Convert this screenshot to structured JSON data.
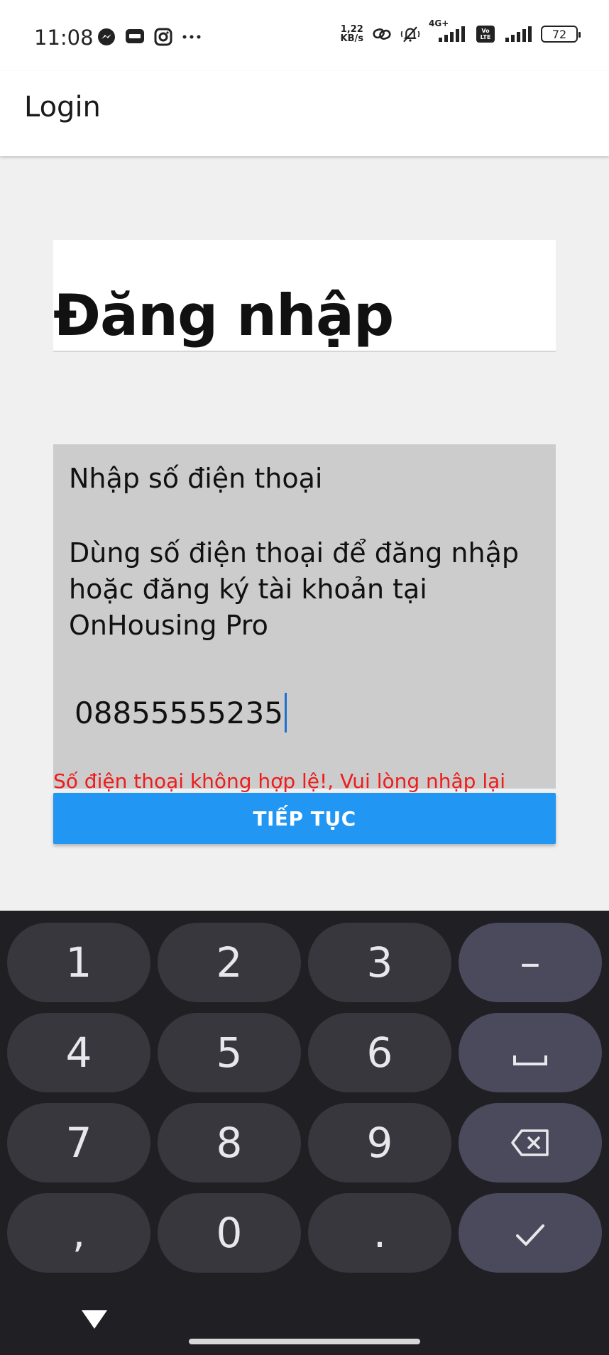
{
  "status_bar": {
    "time": "11:08",
    "left_icons": [
      "messenger-icon",
      "zalo-icon",
      "instagram-icon",
      "more-icon"
    ],
    "net_speed_value": "1,22",
    "net_speed_unit": "KB/s",
    "network_label": "4G+",
    "volte_label": "Vo LTE",
    "battery": "72"
  },
  "app_bar": {
    "title": "Login"
  },
  "main": {
    "heading": "Đăng nhập",
    "form_title": "Nhập số điện thoại",
    "form_description": "Dùng số điện thoại để đăng nhập hoặc đăng ký tài khoản tại OnHousing Pro",
    "phone_value": "08855555235",
    "error_message": "Số điện thoại không hợp lệ!, Vui lòng nhập lại",
    "continue_label": "TIẾP TỤC",
    "colors": {
      "primary": "#2196f3",
      "error": "#ee1c1c",
      "card": "#cccccc"
    }
  },
  "keyboard": {
    "keys": [
      {
        "label": "1",
        "kind": "digit"
      },
      {
        "label": "2",
        "kind": "digit"
      },
      {
        "label": "3",
        "kind": "digit"
      },
      {
        "label": "–",
        "kind": "func"
      },
      {
        "label": "4",
        "kind": "digit"
      },
      {
        "label": "5",
        "kind": "digit"
      },
      {
        "label": "6",
        "kind": "digit"
      },
      {
        "label": "space",
        "kind": "func",
        "icon": "space-icon"
      },
      {
        "label": "7",
        "kind": "digit"
      },
      {
        "label": "8",
        "kind": "digit"
      },
      {
        "label": "9",
        "kind": "digit"
      },
      {
        "label": "backspace",
        "kind": "func",
        "icon": "backspace-icon"
      },
      {
        "label": ",",
        "kind": "digit"
      },
      {
        "label": "0",
        "kind": "digit"
      },
      {
        "label": ".",
        "kind": "digit"
      },
      {
        "label": "done",
        "kind": "func",
        "icon": "check-icon"
      }
    ]
  }
}
